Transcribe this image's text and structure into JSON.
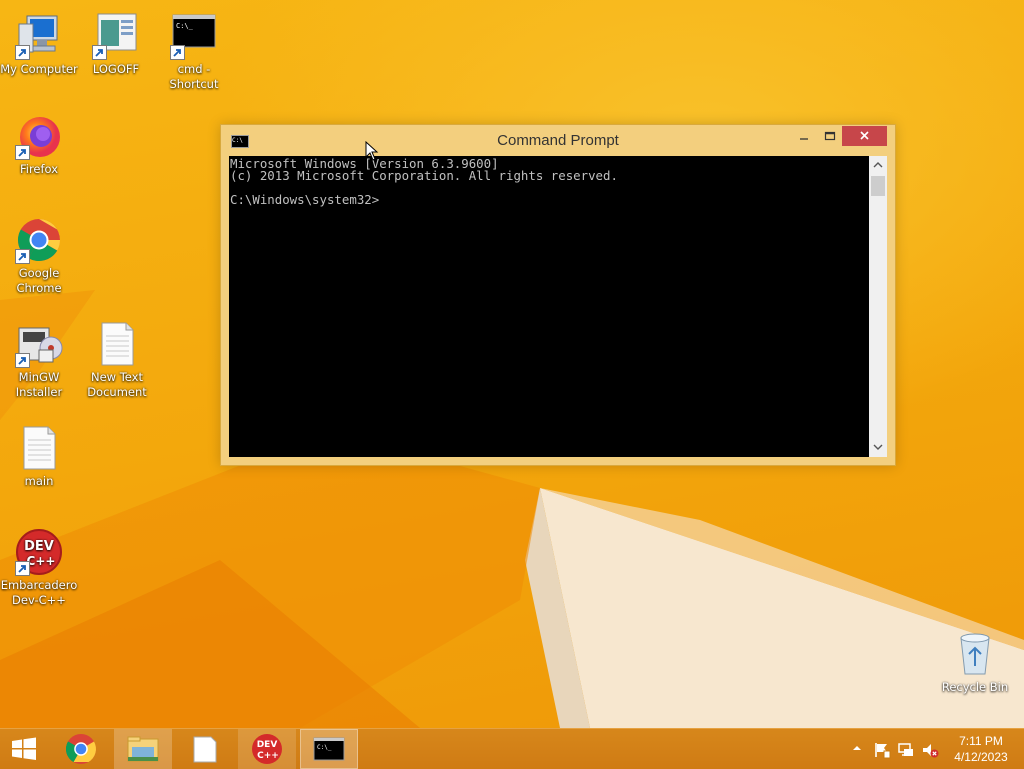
{
  "desktop": {
    "icons": [
      {
        "label": "My Computer",
        "icon": "computer-icon"
      },
      {
        "label": "LOGOFF",
        "icon": "logoff-icon"
      },
      {
        "label": "cmd - Shortcut",
        "icon": "cmd-icon"
      },
      {
        "label": "Firefox",
        "icon": "firefox-icon"
      },
      {
        "label": "Google Chrome",
        "icon": "chrome-icon"
      },
      {
        "label": "MinGW Installer",
        "icon": "mingw-installer-icon"
      },
      {
        "label": "New Text Document",
        "icon": "text-document-icon"
      },
      {
        "label": "main",
        "icon": "text-document-icon"
      },
      {
        "label": "Embarcadero Dev-C++",
        "icon": "devcpp-icon"
      },
      {
        "label": "Recycle Bin",
        "icon": "recycle-bin-icon"
      }
    ]
  },
  "cmd_window": {
    "title": "Command Prompt",
    "icon_text": "C:\\",
    "console_lines": [
      "Microsoft Windows [Version 6.3.9600]",
      "(c) 2013 Microsoft Corporation. All rights reserved.",
      "",
      "C:\\Windows\\system32>"
    ]
  },
  "taskbar": {
    "buttons": [
      {
        "name": "start-button",
        "icon": "windows-logo-icon"
      },
      {
        "name": "chrome",
        "icon": "chrome-icon"
      },
      {
        "name": "file-explorer",
        "icon": "folder-icon"
      },
      {
        "name": "notepad",
        "icon": "document-icon"
      },
      {
        "name": "devcpp",
        "icon": "devcpp-icon",
        "text": "DEV C++"
      },
      {
        "name": "cmd",
        "icon": "cmd-icon",
        "active": true
      }
    ],
    "tray": {
      "time": "7:11 PM",
      "date": "4/12/2023",
      "icons": [
        "show-hidden-icons-icon",
        "action-center-flag-icon",
        "network-icon",
        "volume-muted-icon"
      ]
    }
  },
  "colors": {
    "wallpaper": "#f6b10b",
    "taskbar": "#d7871b",
    "window_frame": "#f3cf7e",
    "close_button": "#c7464a",
    "console_bg": "#000000",
    "console_text": "#c0c0c0"
  }
}
